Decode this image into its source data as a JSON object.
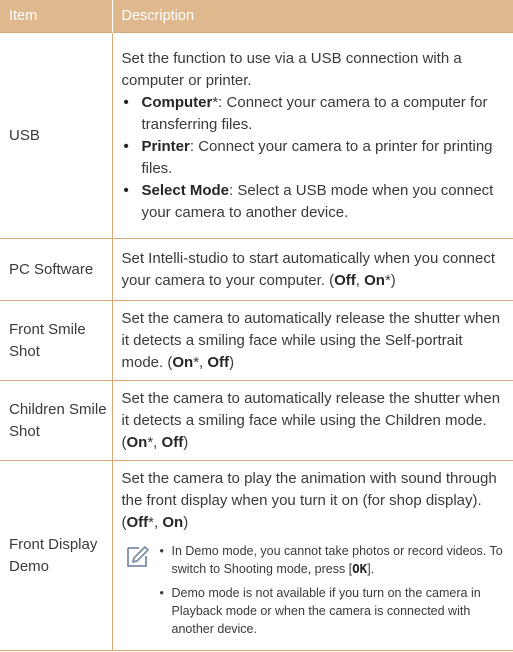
{
  "header": {
    "item": "Item",
    "description": "Description"
  },
  "rows": {
    "usb": {
      "item": "USB",
      "intro": "Set the function to use via a USB connection with a computer or printer.",
      "options": [
        {
          "bold": "Computer",
          "rest": "*: Connect your camera to a computer for transferring files."
        },
        {
          "bold": "Printer",
          "rest": ": Connect your camera to a printer for printing files."
        },
        {
          "bold": "Select Mode",
          "rest": ": Select a USB mode when you connect your camera to another device."
        }
      ]
    },
    "pc_software": {
      "item": "PC Software",
      "text": "Set Intelli-studio to start automatically when you connect your camera to your computer. (",
      "opt1": "Off",
      "sep": ", ",
      "opt2": "On",
      "close": "*)"
    },
    "front_smile": {
      "item": "Front Smile Shot",
      "text": "Set the camera to automatically release the shutter when it detects a smiling face while using the Self-portrait mode. (",
      "opt1": "On",
      "sep": "*, ",
      "opt2": "Off",
      "close": ")"
    },
    "children_smile": {
      "item": "Children Smile Shot",
      "text": "Set the camera to automatically release the shutter when it detects a smiling face while using the Children mode. (",
      "opt1": "On",
      "sep": "*, ",
      "opt2": "Off",
      "close": ")"
    },
    "front_display_demo": {
      "item": "Front Display Demo",
      "text": "Set the camera to play the animation with sound through the front display when you turn it on (for shop display). (",
      "opt1": "Off",
      "sep": "*, ",
      "opt2": "On",
      "close": ")",
      "note_icon": "note-pencil-icon",
      "notes": {
        "n1_text": "In Demo mode, you cannot take photos or record videos. To switch to Shooting mode, press [",
        "n1_key": "OK",
        "n1_close": "].",
        "n2_text": "Demo mode is not available if you turn on the camera in Playback mode or when the camera is connected with another device."
      }
    }
  },
  "colors": {
    "header_bg": "#e0b88e",
    "rule": "#d9a97a",
    "text": "#3a3a3a",
    "icon": "#7b8fa6"
  }
}
